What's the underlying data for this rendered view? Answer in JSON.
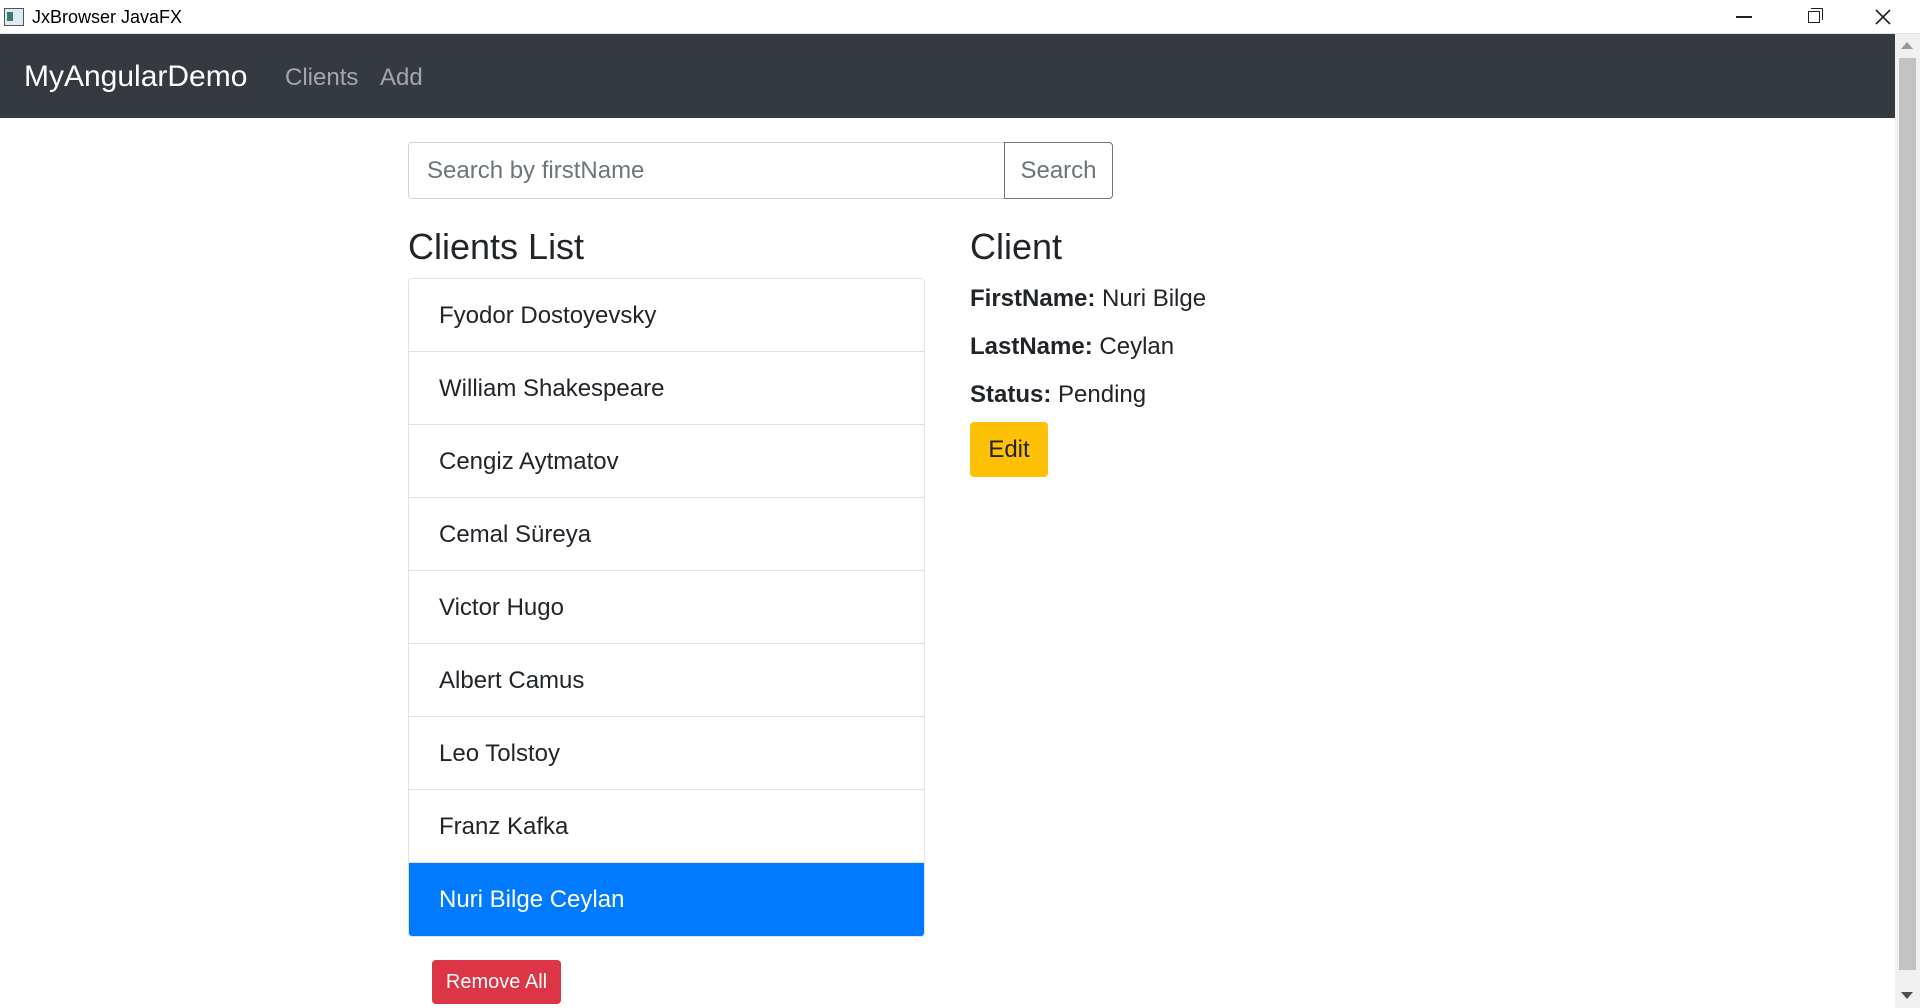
{
  "window": {
    "title": "JxBrowser JavaFX",
    "icons": [
      "app-icon",
      "minimize-icon",
      "maximize-icon",
      "close-icon"
    ]
  },
  "navbar": {
    "brand": "MyAngularDemo",
    "links": [
      {
        "label": "Clients"
      },
      {
        "label": "Add"
      }
    ]
  },
  "search": {
    "placeholder": "Search by firstName",
    "value": "",
    "button_label": "Search"
  },
  "clients_list": {
    "title": "Clients List",
    "items": [
      {
        "name": "Fyodor Dostoyevsky",
        "active": false
      },
      {
        "name": "William Shakespeare",
        "active": false
      },
      {
        "name": "Cengiz Aytmatov",
        "active": false
      },
      {
        "name": "Cemal Süreya",
        "active": false
      },
      {
        "name": "Victor Hugo",
        "active": false
      },
      {
        "name": "Albert Camus",
        "active": false
      },
      {
        "name": "Leo Tolstoy",
        "active": false
      },
      {
        "name": "Franz Kafka",
        "active": false
      },
      {
        "name": "Nuri Bilge Ceylan",
        "active": true
      }
    ],
    "remove_all_label": "Remove All"
  },
  "client_detail": {
    "title": "Client",
    "first_name_label": "FirstName:",
    "first_name": "Nuri Bilge",
    "last_name_label": "LastName:",
    "last_name": "Ceylan",
    "status_label": "Status:",
    "status": "Pending",
    "edit_label": "Edit"
  },
  "colors": {
    "navbar_bg": "#343a40",
    "active_item_bg": "#007bff",
    "edit_button_bg": "#ffc107",
    "remove_button_bg": "#dc3545"
  }
}
